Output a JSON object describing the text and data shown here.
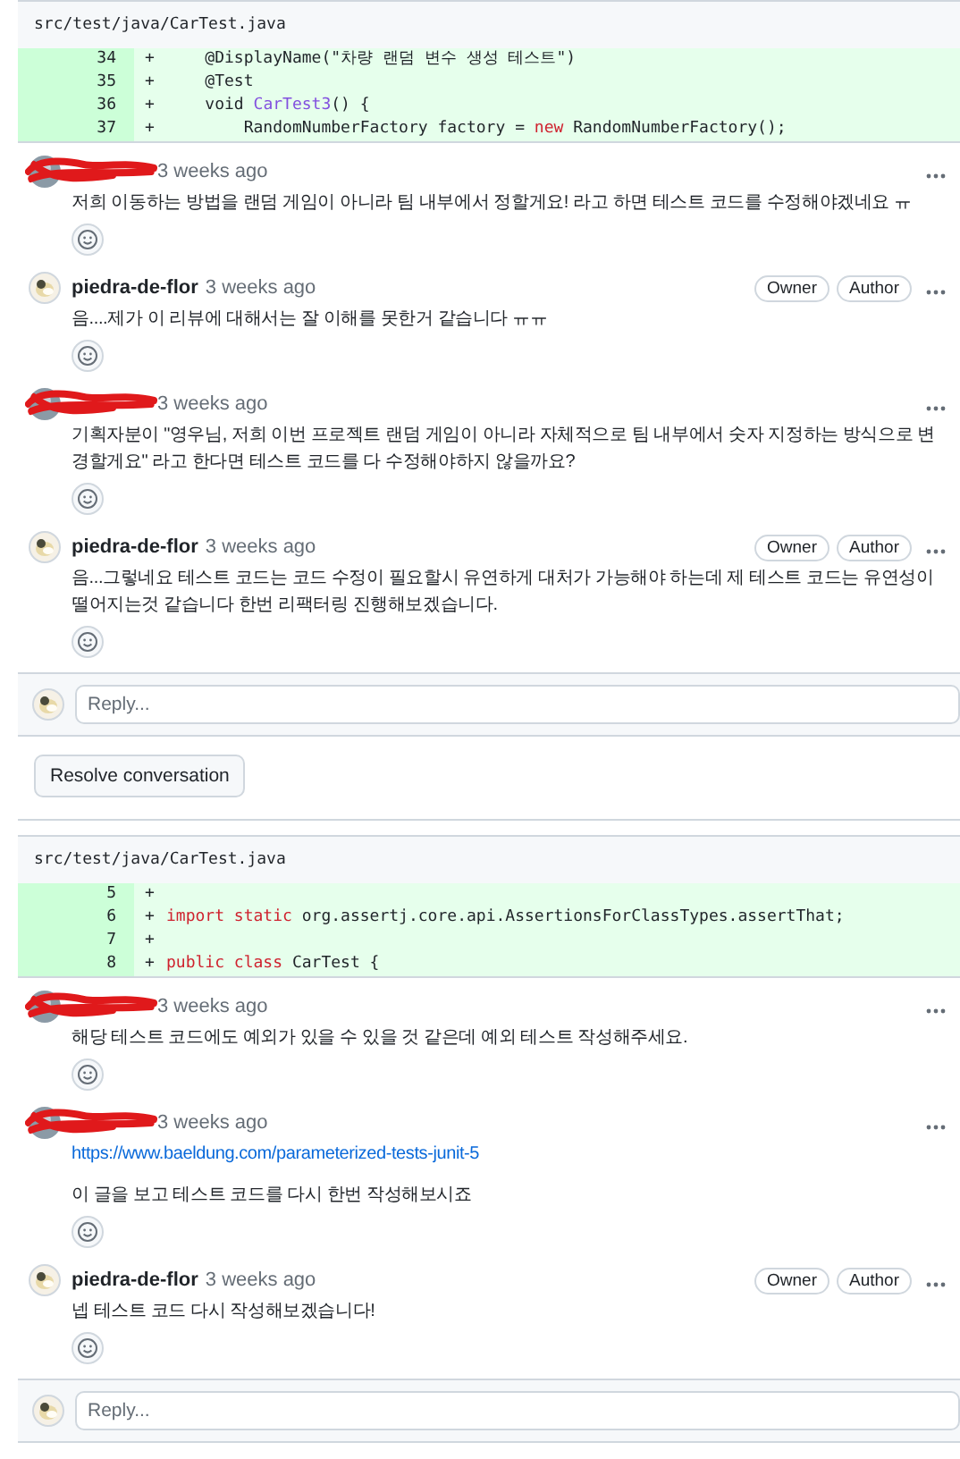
{
  "threads": [
    {
      "file": "src/test/java/CarTest.java",
      "lines": [
        {
          "number": "34",
          "sign": "+",
          "tokens": [
            {
              "text": "    @DisplayName(\"차량 랜덤 변수 생성 테스트\")",
              "kind": "plain"
            }
          ]
        },
        {
          "number": "35",
          "sign": "+",
          "tokens": [
            {
              "text": "    @Test",
              "kind": "plain"
            }
          ]
        },
        {
          "number": "36",
          "sign": "+",
          "tokens": [
            {
              "text": "    void ",
              "kind": "plain"
            },
            {
              "text": "CarTest3",
              "kind": "func"
            },
            {
              "text": "() {",
              "kind": "plain"
            }
          ]
        },
        {
          "number": "37",
          "sign": "+",
          "tokens": [
            {
              "text": "        RandomNumberFactory factory = ",
              "kind": "plain"
            },
            {
              "text": "new",
              "kind": "keyword"
            },
            {
              "text": " RandomNumberFactory();",
              "kind": "plain"
            }
          ]
        }
      ],
      "comments": [
        {
          "redacted": true,
          "time": "3 weeks ago",
          "body": [
            {
              "kind": "text",
              "text": "저희 이동하는 방법을 랜덤 게임이 아니라 팀 내부에서 정할게요! 라고 하면 테스트 코드를 수정해야겠네요 ㅠ"
            }
          ]
        },
        {
          "redacted": false,
          "author": "piedra-de-flor",
          "time": "3 weeks ago",
          "badges": [
            "Owner",
            "Author"
          ],
          "body": [
            {
              "kind": "text",
              "text": "음....제가 이 리뷰에 대해서는 잘 이해를 못한거 같습니다 ㅠㅠ"
            }
          ]
        },
        {
          "redacted": true,
          "time": "3 weeks ago",
          "body": [
            {
              "kind": "text",
              "text": "기획자분이 \"영우님, 저희 이번 프로젝트 랜덤 게임이 아니라 자체적으로 팀 내부에서 숫자 지정하는 방식으로 변경할게요\" 라고 한다면 테스트 코드를 다 수정해야하지 않을까요?"
            }
          ]
        },
        {
          "redacted": false,
          "author": "piedra-de-flor",
          "time": "3 weeks ago",
          "badges": [
            "Owner",
            "Author"
          ],
          "body": [
            {
              "kind": "text",
              "text": "음...그렇네요 테스트 코드는 코드 수정이 필요할시 유연하게 대처가 가능해야 하는데 제 테스트 코드는 유연성이 떨어지는것 같습니다 한번 리팩터링 진행해보겠습니다."
            }
          ]
        }
      ],
      "reply_placeholder": "Reply...",
      "resolve_button": "Resolve conversation"
    },
    {
      "file": "src/test/java/CarTest.java",
      "lines": [
        {
          "number": "5",
          "sign": "+"
        },
        {
          "number": "6",
          "sign": "+",
          "tokens": [
            {
              "text": "import static",
              "kind": "keyword"
            },
            {
              "text": " org.assertj.core.api.AssertionsForClassTypes.assertThat;",
              "kind": "plain"
            }
          ]
        },
        {
          "number": "7",
          "sign": "+"
        },
        {
          "number": "8",
          "sign": "+",
          "tokens": [
            {
              "text": "public class",
              "kind": "keyword"
            },
            {
              "text": " CarTest {",
              "kind": "plain"
            }
          ]
        }
      ],
      "comments": [
        {
          "redacted": true,
          "time": "3 weeks ago",
          "body": [
            {
              "kind": "text",
              "text": "해당 테스트 코드에도 예외가 있을 수 있을 것 같은데 예외 테스트 작성해주세요."
            }
          ]
        },
        {
          "redacted": true,
          "time": "3 weeks ago",
          "body": [
            {
              "kind": "link",
              "text": "https://www.baeldung.com/parameterized-tests-junit-5"
            },
            {
              "kind": "text",
              "text": "이 글을 보고 테스트 코드를 다시 한번 작성해보시죠"
            }
          ]
        },
        {
          "redacted": false,
          "author": "piedra-de-flor",
          "time": "3 weeks ago",
          "badges": [
            "Owner",
            "Author"
          ],
          "body": [
            {
              "kind": "text",
              "text": "넵 테스트 코드 다시 작성해보겠습니다!"
            }
          ]
        }
      ],
      "reply_placeholder": "Reply..."
    }
  ]
}
